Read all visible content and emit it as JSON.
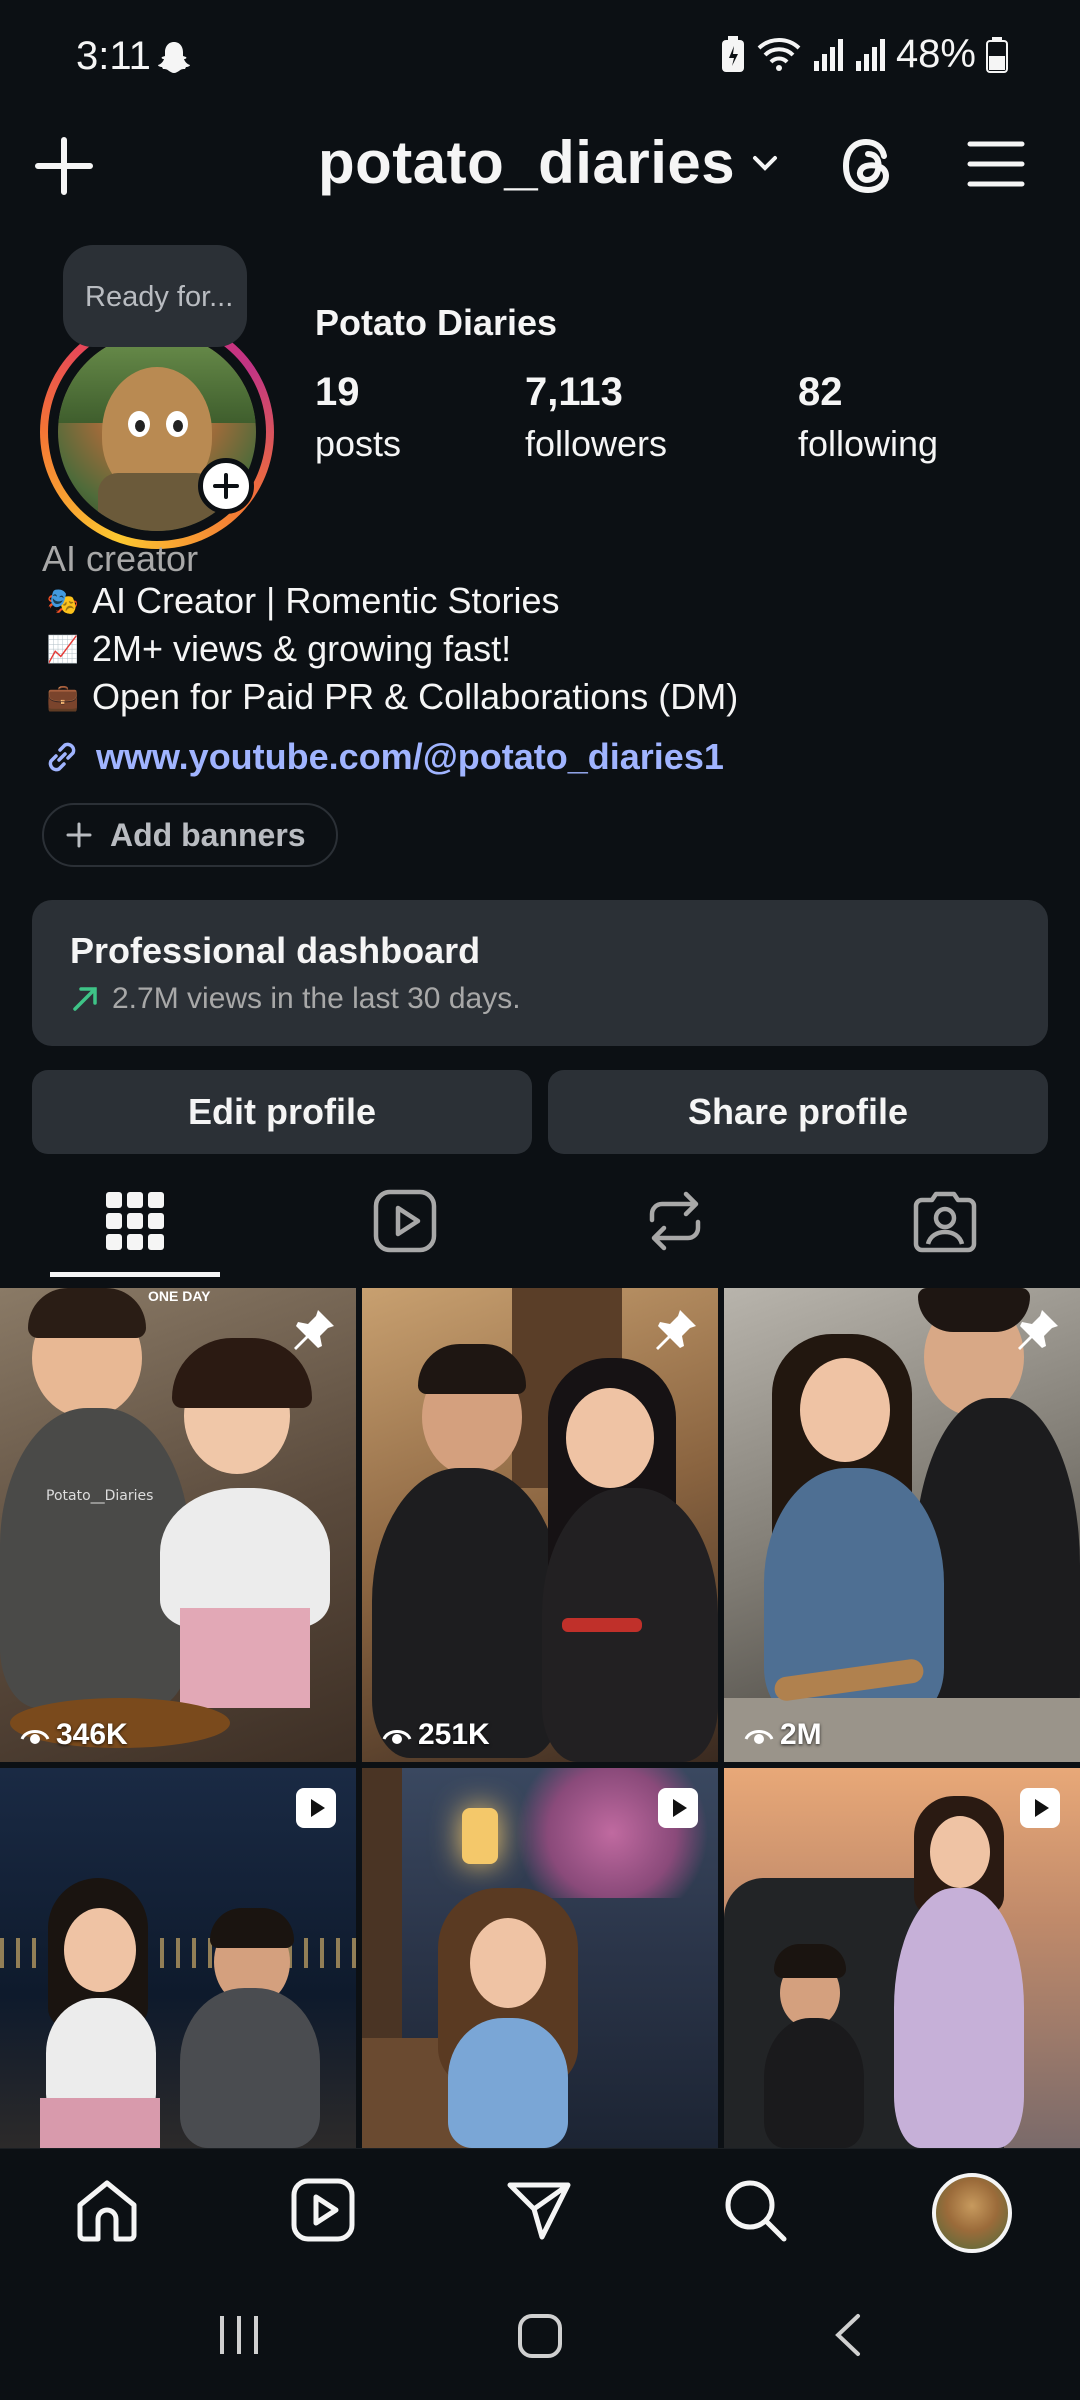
{
  "status_bar": {
    "time": "3:11",
    "battery": "48%"
  },
  "header": {
    "username": "potato_diaries"
  },
  "profile": {
    "tooltip": "Ready for...",
    "display_name": "Potato Diaries",
    "stats": [
      {
        "value": "19",
        "label": "posts"
      },
      {
        "value": "7,113",
        "label": "followers"
      },
      {
        "value": "82",
        "label": "following"
      }
    ],
    "category": "AI creator",
    "bio": [
      {
        "emoji": "🎭",
        "text": "AI Creator | Romentic Stories"
      },
      {
        "emoji": "📈",
        "text": "2M+ views & growing fast!"
      },
      {
        "emoji": "💼",
        "text": "Open for Paid PR & Collaborations (DM)"
      }
    ],
    "link": "www.youtube.com/@potato_diaries1",
    "add_banners": "Add banners"
  },
  "dashboard": {
    "title": "Professional dashboard",
    "subtitle": "2.7M views in the last 30 days."
  },
  "buttons": {
    "edit": "Edit profile",
    "share": "Share profile"
  },
  "tabs": [
    "grid-icon",
    "reels-icon",
    "reposts-icon",
    "tagged-icon"
  ],
  "posts": [
    {
      "type": "pinned",
      "views": "346K",
      "shirt_text": "Potato__Diaries",
      "overlay": "ONE DAY"
    },
    {
      "type": "pinned",
      "views": "251K"
    },
    {
      "type": "pinned",
      "views": "2M"
    },
    {
      "type": "reel"
    },
    {
      "type": "reel"
    },
    {
      "type": "reel"
    }
  ],
  "colors": {
    "background": "#0c1014",
    "card": "#2b3036",
    "link": "#a0b4ff",
    "trend": "#3ec487"
  }
}
